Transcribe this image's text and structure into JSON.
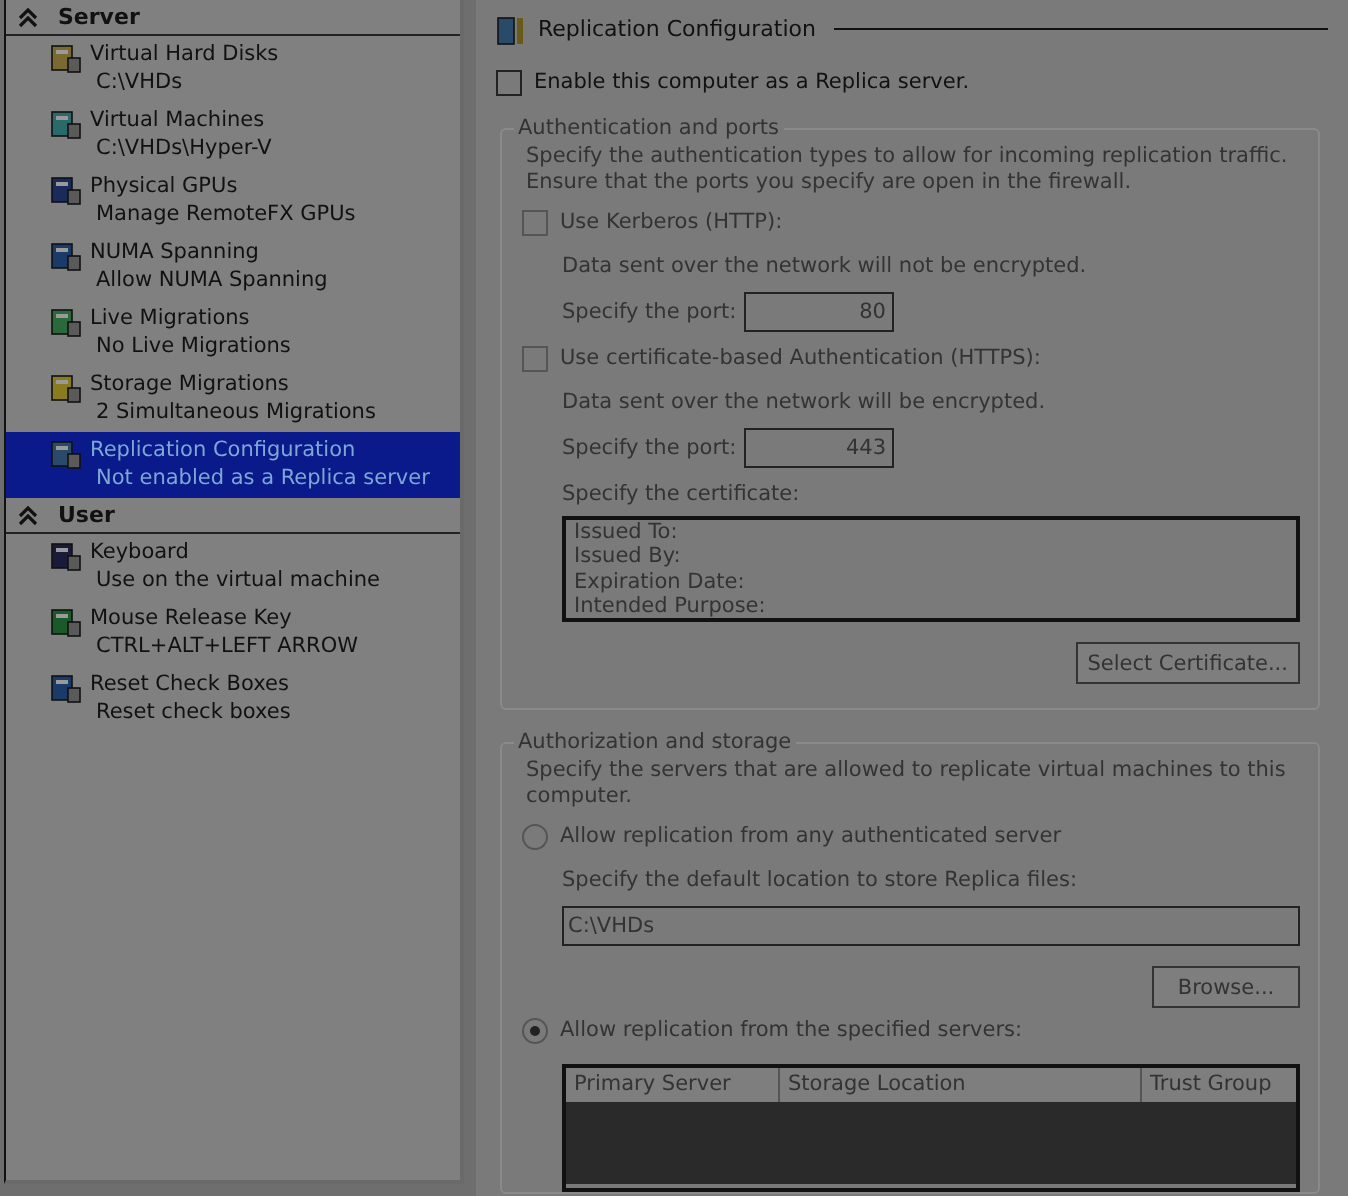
{
  "sidebar": {
    "sections": [
      {
        "title": "Server",
        "expanded": true,
        "items": [
          {
            "title": "Virtual Hard Disks",
            "subtitle": "C:\\VHDs",
            "selected": false
          },
          {
            "title": "Virtual Machines",
            "subtitle": "C:\\VHDs\\Hyper-V",
            "selected": false
          },
          {
            "title": "Physical GPUs",
            "subtitle": "Manage RemoteFX GPUs",
            "selected": false
          },
          {
            "title": "NUMA Spanning",
            "subtitle": "Allow NUMA Spanning",
            "selected": false
          },
          {
            "title": "Live Migrations",
            "subtitle": "No Live Migrations",
            "selected": false
          },
          {
            "title": "Storage Migrations",
            "subtitle": "2 Simultaneous Migrations",
            "selected": false
          },
          {
            "title": "Replication Configuration",
            "subtitle": "Not enabled as a Replica server",
            "selected": true
          }
        ]
      },
      {
        "title": "User",
        "expanded": true,
        "items": [
          {
            "title": "Keyboard",
            "subtitle": "Use on the virtual machine",
            "selected": false
          },
          {
            "title": "Mouse Release Key",
            "subtitle": "CTRL+ALT+LEFT ARROW",
            "selected": false
          },
          {
            "title": "Reset Check Boxes",
            "subtitle": "Reset check boxes",
            "selected": false
          }
        ]
      }
    ]
  },
  "panel": {
    "title": "Replication Configuration",
    "enable": {
      "label": "Enable this computer as a Replica server.",
      "checked": false
    },
    "auth": {
      "title": "Authentication and ports",
      "disabled": true,
      "description": "Specify the authentication types to allow for incoming replication traffic. Ensure that the ports you specify are open in the firewall.",
      "options": [
        {
          "label": "Use Kerberos (HTTP):",
          "checked": false,
          "note": "Data sent over the network will not be encrypted.",
          "port_label": "Specify the port:",
          "port": "80"
        },
        {
          "label": "Use certificate-based Authentication (HTTPS):",
          "checked": false,
          "note": "Data sent over the network will be encrypted.",
          "port_label": "Specify the port:",
          "port": "443"
        }
      ],
      "certificate_label": "Specify the certificate:",
      "certificate_fields": [
        "Issued To:",
        "Issued By:",
        "Expiration Date:",
        "Intended Purpose:"
      ],
      "button": "Select Certificate..."
    },
    "authorization": {
      "title": "Authorization and storage",
      "disabled": true,
      "description": "Specify the servers that are allowed to replicate virtual machines to this computer.",
      "any": {
        "label": "Allow replication from any authenticated server",
        "selected": false,
        "location_label": "Specify the default location to store Replica files:",
        "location": "C:\\VHDs",
        "button": "Browse..."
      },
      "specified": {
        "label": "Allow replication from the specified servers:",
        "selected": true
      },
      "table": {
        "columns": [
          "Primary Server",
          "Storage Location",
          "Trust Group"
        ]
      }
    }
  }
}
